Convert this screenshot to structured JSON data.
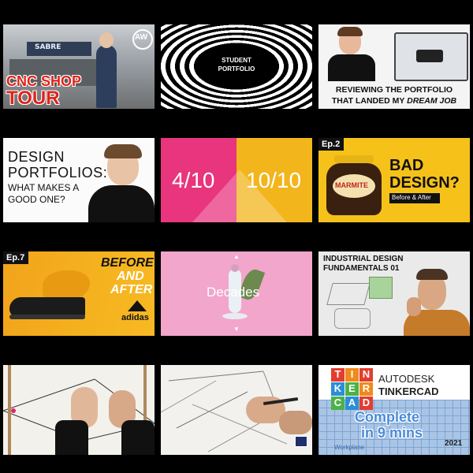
{
  "grid": {
    "t1": {
      "title_line1": "CNC SHOP",
      "title_line2": "TOUR",
      "logo": "AW",
      "machine_text": "SABRE"
    },
    "t2": {
      "line1": "STUDENT",
      "line2": "PORTFOLIO"
    },
    "t3": {
      "line1": "REVIEWING THE PORTFOLIO",
      "line2": "THAT LANDED MY ",
      "line2_em": "DREAM JOB"
    },
    "t4": {
      "line1": "DESIGN",
      "line2": "PORTFOLIOS:",
      "line3": "WHAT MAKES A",
      "line4": "GOOD ONE?"
    },
    "t5": {
      "left": "4/10",
      "right": "10/10"
    },
    "t6": {
      "ep": "Ep.2",
      "line1": "BAD",
      "line2": "DESIGN?",
      "sub": "Before & After",
      "jar_label": "MARMITE"
    },
    "t7": {
      "ep": "Ep.7",
      "line1": "BEFORE",
      "line2": "AND",
      "line3": "AFTER",
      "brand": "adidas"
    },
    "t8": {
      "title": "Decades"
    },
    "t9": {
      "line1": "INDUSTRIAL DESIGN",
      "line2": "FUNDAMENTALS 01"
    },
    "t10": {},
    "t11": {},
    "t12": {
      "letters": [
        "T",
        "I",
        "N",
        "K",
        "E",
        "R",
        "C",
        "A",
        "D"
      ],
      "brand1": "AUTODESK",
      "brand2": "TINKERCAD",
      "line1": "Complete",
      "line2": "in 9 mins",
      "year": "2021",
      "plane": "Workplane"
    }
  },
  "colors": {
    "background": "#000000",
    "cnc_red": "#e0241b",
    "mustard": "#f2b51c",
    "pink": "#f2a6cc",
    "magenta": "#e8357e",
    "orange": "#f5a11b",
    "tinker_blue": "#9fbfe0"
  }
}
